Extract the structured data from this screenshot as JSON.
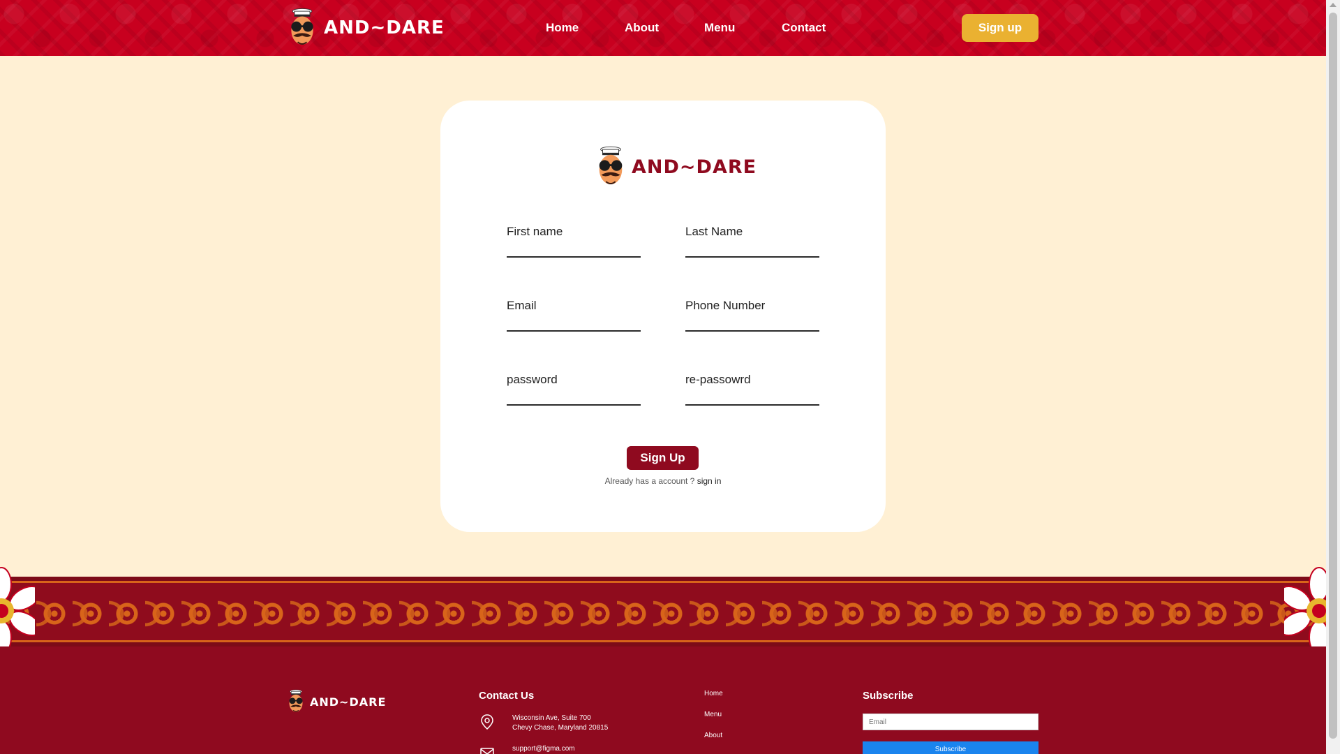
{
  "brand": {
    "name": "AND~DARE"
  },
  "nav": {
    "items": [
      {
        "label": "Home"
      },
      {
        "label": "About"
      },
      {
        "label": "Menu"
      },
      {
        "label": "Contact"
      }
    ],
    "signup_label": "Sign up"
  },
  "form": {
    "fields": [
      {
        "label": "First name",
        "value": ""
      },
      {
        "label": "Last Name",
        "value": ""
      },
      {
        "label": "Email",
        "value": ""
      },
      {
        "label": "Phone Number",
        "value": ""
      },
      {
        "label": "password",
        "value": ""
      },
      {
        "label": "re-passowrd",
        "value": ""
      }
    ],
    "submit_label": "Sign Up",
    "signin_prompt": "Already has a account ?",
    "signin_link": "sign in"
  },
  "footer": {
    "contact_heading": "Contact Us",
    "address_line1": "Wisconsin Ave, Suite 700",
    "address_line2": "Chevy Chase, Maryland 20815",
    "email": "support@figma.com",
    "links": [
      {
        "label": "Home"
      },
      {
        "label": "Menu"
      },
      {
        "label": "About"
      }
    ],
    "subscribe_heading": "Subscribe",
    "subscribe_placeholder": "Email",
    "subscribe_button": "Subscribe"
  },
  "colors": {
    "header_red": "#c8001f",
    "brand_maroon": "#8f0a1f",
    "accent_gold": "#eab131",
    "page_cream": "#fff0d4",
    "subscribe_blue": "#1a84ee",
    "ornament_orange": "#d8641a"
  },
  "icons": [
    "chef-mascot-icon",
    "location-pin-icon",
    "mail-icon",
    "flower-ornament-icon"
  ]
}
